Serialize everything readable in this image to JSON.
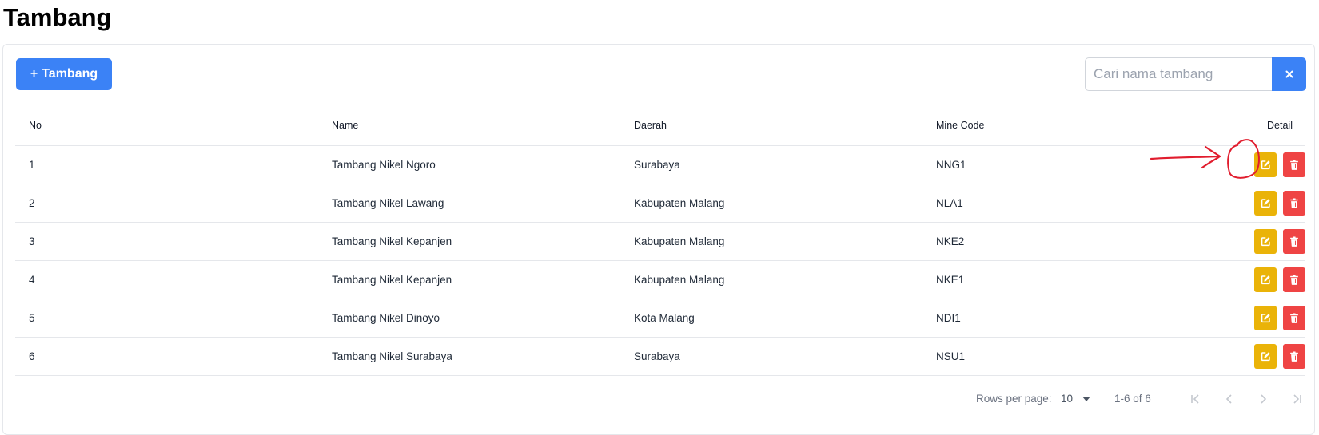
{
  "page": {
    "title": "Tambang"
  },
  "toolbar": {
    "add_label": "Tambang",
    "add_icon": "plus-icon",
    "search_placeholder": "Cari nama tambang",
    "search_value": "",
    "clear_icon": "close-icon"
  },
  "table": {
    "headers": {
      "no": "No",
      "name": "Name",
      "daerah": "Daerah",
      "code": "Mine Code",
      "detail": "Detail"
    },
    "rows": [
      {
        "no": "1",
        "name": "Tambang Nikel Ngoro",
        "daerah": "Surabaya",
        "code": "NNG1"
      },
      {
        "no": "2",
        "name": "Tambang Nikel Lawang",
        "daerah": "Kabupaten Malang",
        "code": "NLA1"
      },
      {
        "no": "3",
        "name": "Tambang Nikel Kepanjen",
        "daerah": "Kabupaten Malang",
        "code": "NKE2"
      },
      {
        "no": "4",
        "name": "Tambang Nikel Kepanjen",
        "daerah": "Kabupaten Malang",
        "code": "NKE1"
      },
      {
        "no": "5",
        "name": "Tambang Nikel Dinoyo",
        "daerah": "Kota Malang",
        "code": "NDI1"
      },
      {
        "no": "6",
        "name": "Tambang Nikel Surabaya",
        "daerah": "Surabaya",
        "code": "NSU1"
      }
    ],
    "row_actions": {
      "edit_icon": "edit-icon",
      "delete_icon": "trash-icon"
    }
  },
  "pagination": {
    "rows_per_page_label": "Rows per page:",
    "rows_per_page_value": "10",
    "range_label": "1-6 of 6"
  },
  "colors": {
    "primary": "#3b82f6",
    "edit": "#eab308",
    "delete": "#ef4444",
    "annotation": "#e11d2e"
  }
}
